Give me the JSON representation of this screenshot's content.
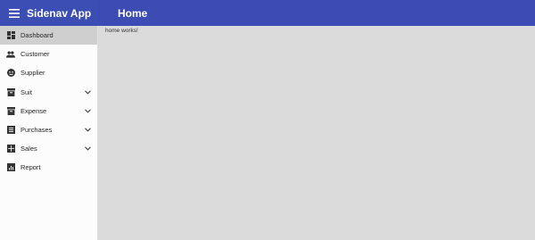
{
  "app": {
    "title": "Sidenav App"
  },
  "header": {
    "page_title": "Home"
  },
  "sidebar": {
    "items": [
      {
        "label": "Dashboard",
        "icon": "dashboard-icon",
        "active": true,
        "expandable": false
      },
      {
        "label": "Customer",
        "icon": "people-icon",
        "active": false,
        "expandable": false
      },
      {
        "label": "Supplier",
        "icon": "face-icon",
        "active": false,
        "expandable": false
      },
      {
        "label": "Suit",
        "icon": "archive-icon",
        "active": false,
        "expandable": true
      },
      {
        "label": "Expense",
        "icon": "archive-icon",
        "active": false,
        "expandable": true
      },
      {
        "label": "Purchases",
        "icon": "list-icon",
        "active": false,
        "expandable": true
      },
      {
        "label": "Sales",
        "icon": "grid-icon",
        "active": false,
        "expandable": true
      },
      {
        "label": "Report",
        "icon": "chart-icon",
        "active": false,
        "expandable": false
      }
    ]
  },
  "main": {
    "text": "home works!"
  },
  "colors": {
    "header": "#3c4cb4",
    "sidebar_bg": "#fcfcfd",
    "content_bg": "#dcdbdc",
    "active_item": "#cfcfd0"
  }
}
